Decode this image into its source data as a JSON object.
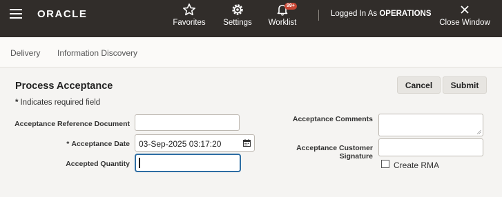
{
  "header": {
    "brand": "ORACLE",
    "favorites_label": "Favorites",
    "settings_label": "Settings",
    "worklist_label": "Worklist",
    "worklist_badge": "99+",
    "logged_in_prefix": "Logged In As ",
    "logged_in_user": "OPERATIONS",
    "close_window_label": "Close Window"
  },
  "nav": {
    "tabs": [
      {
        "label": "Delivery"
      },
      {
        "label": "Information Discovery"
      }
    ]
  },
  "page": {
    "title": "Process Acceptance",
    "required_note_star": "*",
    "required_note": "Indicates required field",
    "cancel_label": "Cancel",
    "submit_label": "Submit"
  },
  "form": {
    "acceptance_reference_document": {
      "label": "Acceptance Reference Document",
      "value": ""
    },
    "acceptance_date": {
      "label": "Acceptance Date",
      "required_star": "*",
      "value": "03-Sep-2025 03:17:20"
    },
    "accepted_quantity": {
      "label": "Accepted Quantity",
      "value": ""
    },
    "acceptance_comments": {
      "label": "Acceptance Comments",
      "value": ""
    },
    "acceptance_customer_signature": {
      "label": "Acceptance Customer Signature",
      "value": ""
    },
    "create_rma": {
      "label": "Create RMA",
      "checked": false
    }
  },
  "icons": {
    "menu": "hamburger-menu-icon",
    "favorites": "star-icon",
    "settings": "gear-icon",
    "worklist": "bell-icon",
    "close": "close-icon",
    "calendar": "calendar-icon"
  },
  "colors": {
    "header_bg": "#312d2a",
    "badge": "#c74634",
    "focus_border": "#2d6da3",
    "page_bg": "#f5f4f2"
  }
}
